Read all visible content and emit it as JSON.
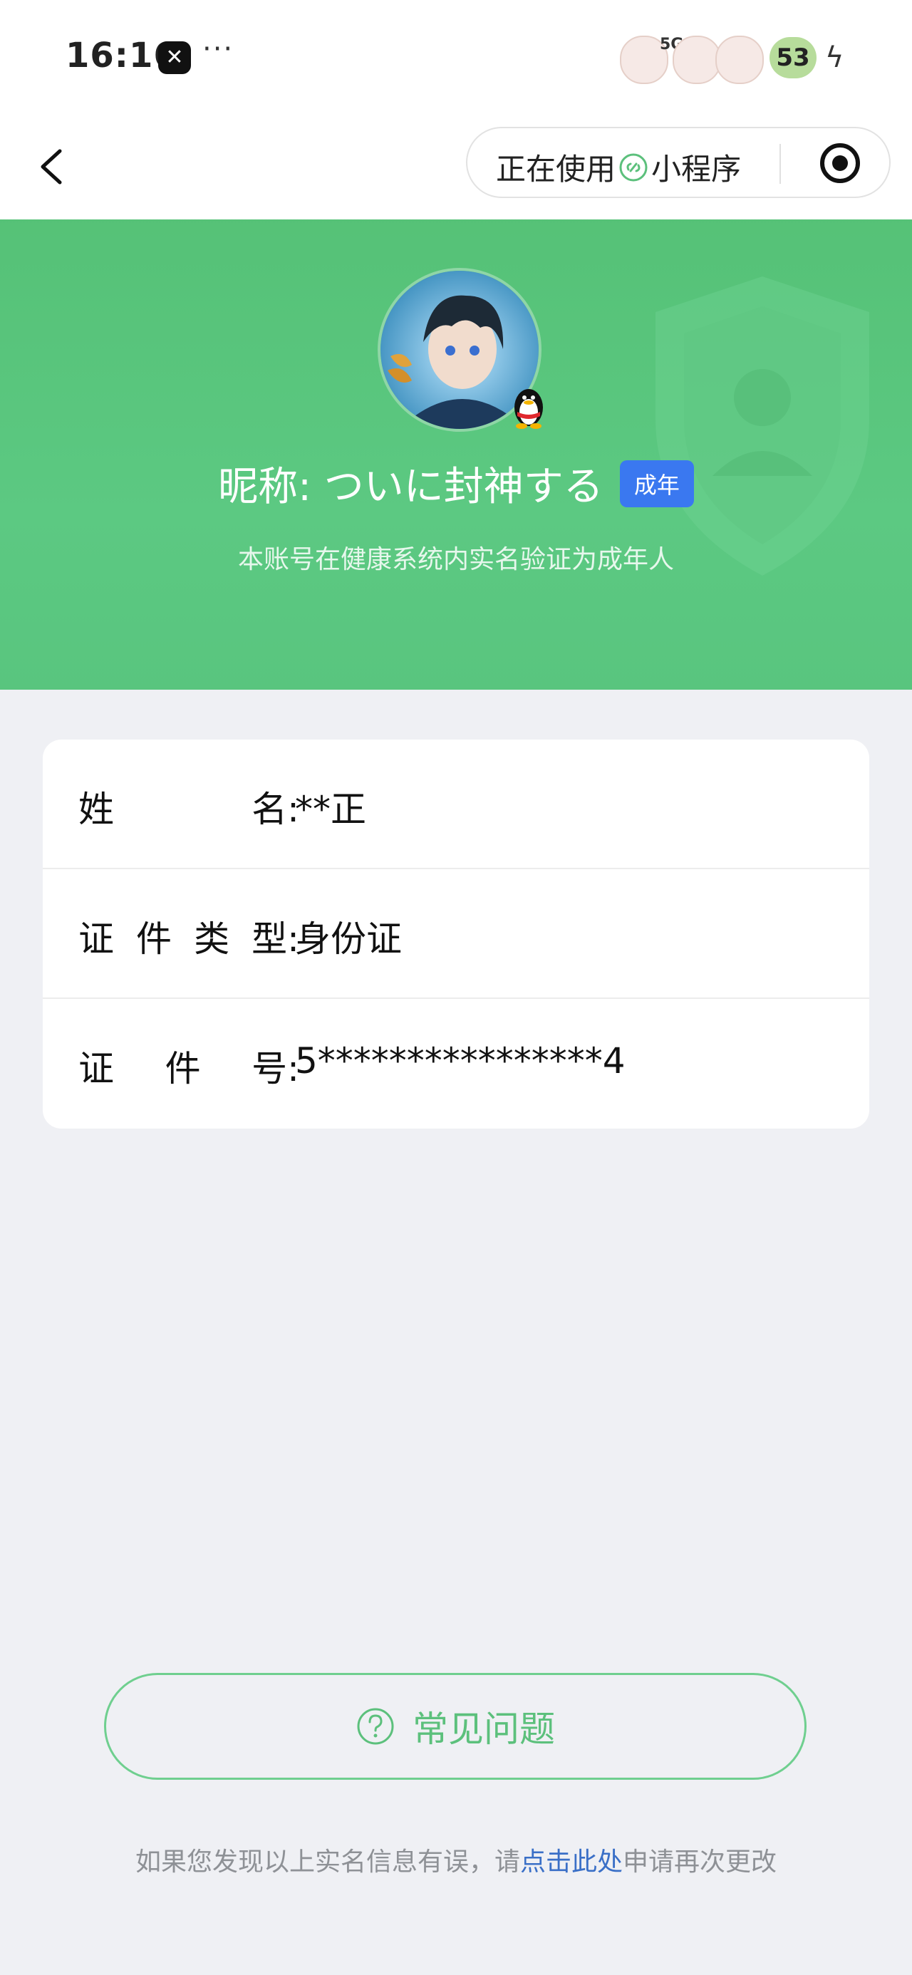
{
  "status_bar": {
    "time": "16:16",
    "app_icon": "capcut-icon",
    "more": "···",
    "network": "5G",
    "battery": "53",
    "charging_icon": "bolt-icon"
  },
  "nav": {
    "back_icon": "chevron-left-icon",
    "capsule_prefix": "正在使用",
    "capsule_suffix": "小程序",
    "capsule_icon": "mini-program-link-icon",
    "record_icon": "record-icon"
  },
  "profile": {
    "nickname": "昵称: ついに封神する",
    "badge": "成年",
    "subtitle": "本账号在健康系统内实名验证为成年人",
    "avatar_icon": "avatar",
    "qq_icon": "qq-penguin-icon"
  },
  "info": {
    "rows": [
      {
        "label_chars": [
          "姓",
          "名:"
        ],
        "value": "**正"
      },
      {
        "label_chars": [
          "证",
          "件",
          "类",
          "型:"
        ],
        "value": "身份证"
      },
      {
        "label_chars": [
          "证",
          "件",
          "号:"
        ],
        "value": "5****************4"
      }
    ]
  },
  "faq": {
    "label": "常见问题",
    "icon": "question-circle-icon"
  },
  "footer": {
    "prefix": "如果您发现以上实名信息有误，请",
    "link": "点击此处",
    "suffix": "申请再次更改"
  },
  "colors": {
    "hero_green": "#5cc982",
    "badge_blue": "#3a78f0",
    "link_blue": "#3a6fc7",
    "faq_green": "#5cc07c"
  }
}
